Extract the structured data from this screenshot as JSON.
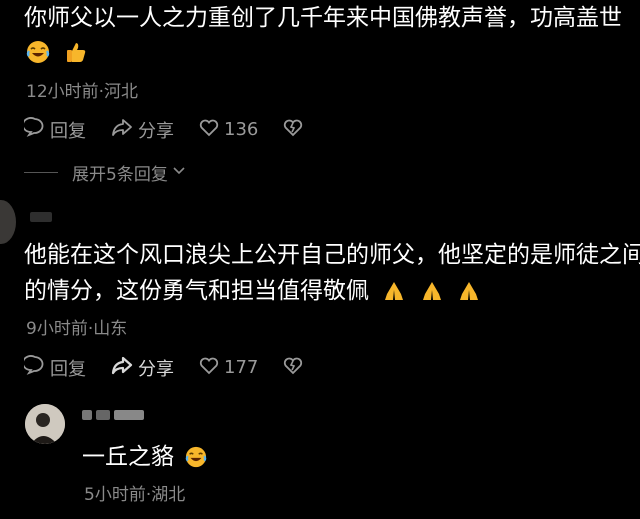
{
  "comment1": {
    "text": "你师父以一人之力重创了几千年来中国佛教声誉，功高盖世",
    "meta": "12小时前·河北",
    "reply_label": "回复",
    "share_label": "分享",
    "like_count": "136",
    "expand_label": "展开5条回复"
  },
  "comment2": {
    "line1": "他能在这个风口浪尖上公开自己的师父，他坚定的是师徒之间",
    "line2": "的情分，这份勇气和担当值得敬佩",
    "meta": "9小时前·山东",
    "reply_label": "回复",
    "share_label": "分享",
    "like_count": "177"
  },
  "reply1": {
    "text": "一丘之貉",
    "meta": "5小时前·湖北"
  },
  "colors": {
    "background": "#000000",
    "text": "#ffffff",
    "meta": "#8a8a8a",
    "emoji_yellow": "#f7b62b"
  },
  "icons": [
    "laughing-tears-emoji",
    "thumbs-up-emoji",
    "pray-emoji",
    "reply-bubble-icon",
    "share-arrow-icon",
    "heart-icon",
    "broken-heart-icon",
    "chevron-down-icon"
  ]
}
